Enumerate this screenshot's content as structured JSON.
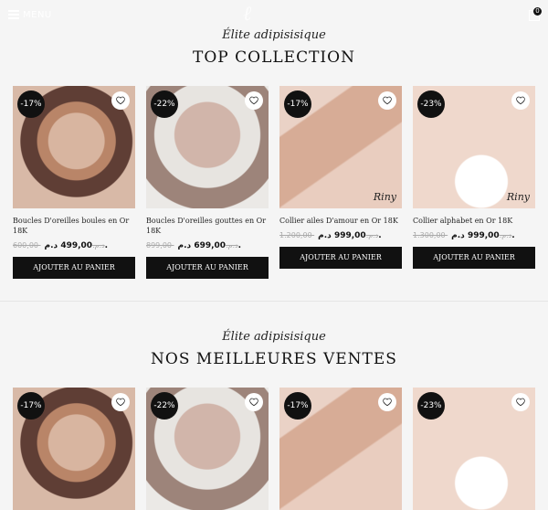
{
  "header": {
    "menu_label": "MENU",
    "cart_count": "0"
  },
  "section1": {
    "subtitle": "Élite adipisisique",
    "title": "TOP COLLECTION",
    "products": [
      {
        "discount": "-17%",
        "name": "Boucles D'oreilles boules en Or 18K",
        "old_price": "600,00 د.م.",
        "new_price": "499,00 د.م.",
        "button": "AJOUTER AU PANIER"
      },
      {
        "discount": "-22%",
        "name": "Boucles D'oreilles gouttes en Or 18K",
        "old_price": "899,00 د.م.",
        "new_price": "699,00 د.م.",
        "button": "AJOUTER AU PANIER"
      },
      {
        "discount": "-17%",
        "name": "Collier ailes D'amour en Or 18K",
        "old_price": "1.200,00 د.م.",
        "new_price": "999,00 د.م.",
        "button": "AJOUTER AU PANIER",
        "signature": "Riny"
      },
      {
        "discount": "-23%",
        "name": "Collier alphabet en Or 18K",
        "old_price": "1.300,00 د.م.",
        "new_price": "999,00 د.م.",
        "button": "AJOUTER AU PANIER",
        "signature": "Riny"
      }
    ]
  },
  "section2": {
    "subtitle": "Élite adipisisique",
    "title": "NOS MEILLEURES VENTES",
    "products": [
      {
        "discount": "-17%"
      },
      {
        "discount": "-22%"
      },
      {
        "discount": "-17%"
      },
      {
        "discount": "-23%"
      }
    ]
  }
}
